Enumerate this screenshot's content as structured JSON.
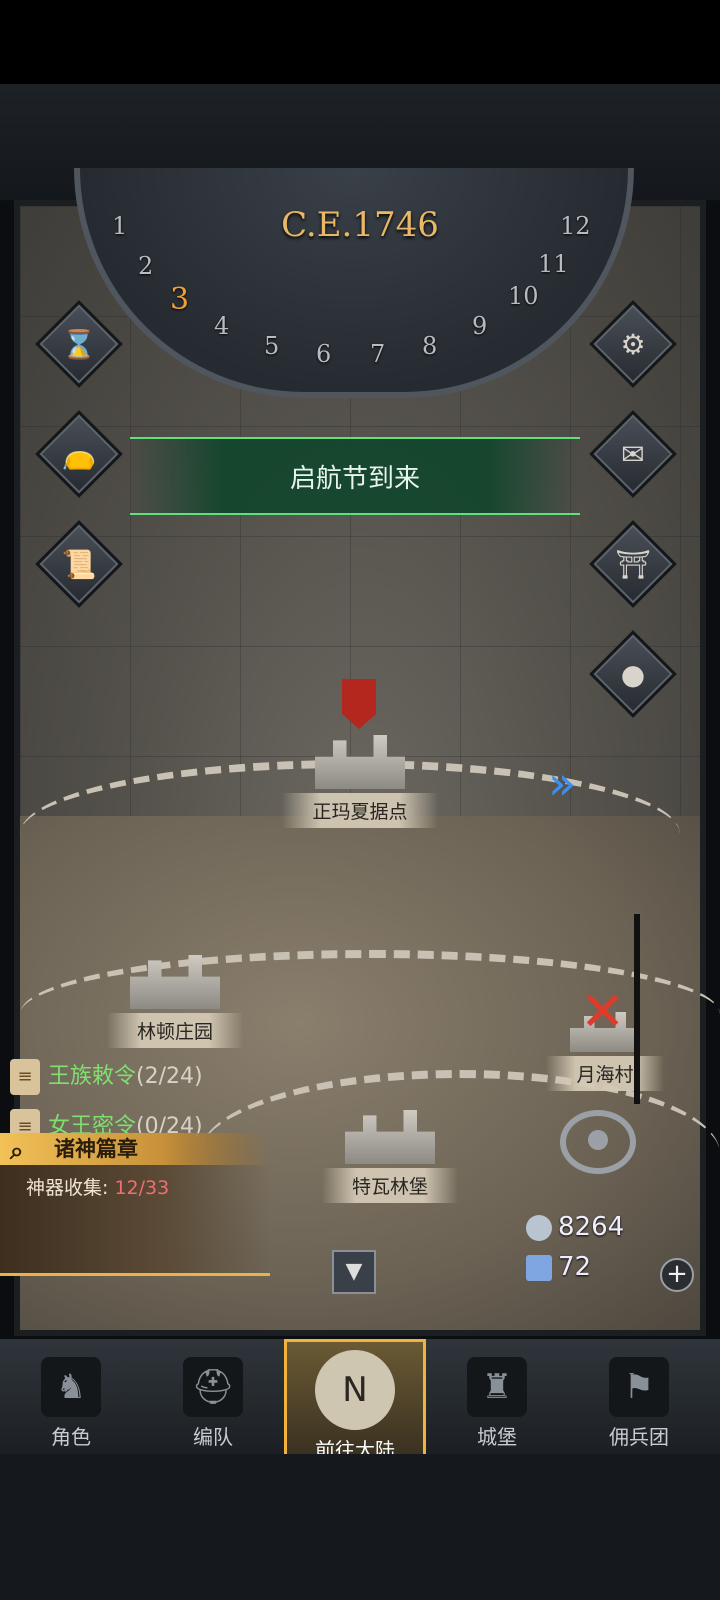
{
  "calendar": {
    "year": "C.E.1746",
    "months": [
      "1",
      "2",
      "3",
      "4",
      "5",
      "6",
      "7",
      "8",
      "9",
      "10",
      "11",
      "12"
    ],
    "current_month": "3"
  },
  "event_banner": "启航节到来",
  "locations": {
    "zhengma": "正玛夏据点",
    "linton": "林顿庄园",
    "moonsea": "月海村",
    "tewa": "特瓦林堡"
  },
  "quests": [
    {
      "name": "王族敕令",
      "count": "(2/24)"
    },
    {
      "name": "女王密令",
      "count": "(0/24)"
    }
  ],
  "gods_chapter": {
    "title": "诸神篇章",
    "progress_label": "神器收集:",
    "progress_value": "12/33"
  },
  "resources": {
    "silver": "8264",
    "crystal": "72"
  },
  "nav_tabs": [
    {
      "label": "角色"
    },
    {
      "label": "编队"
    },
    {
      "label": "前往大陆"
    },
    {
      "label": "城堡"
    },
    {
      "label": "佣兵团"
    }
  ],
  "compass_letter": "N",
  "colors": {
    "accent_gold": "#f2b23e",
    "banner_green": "#5ee07a",
    "year_text": "#e9b866",
    "progress_red": "#ee6f6f"
  }
}
